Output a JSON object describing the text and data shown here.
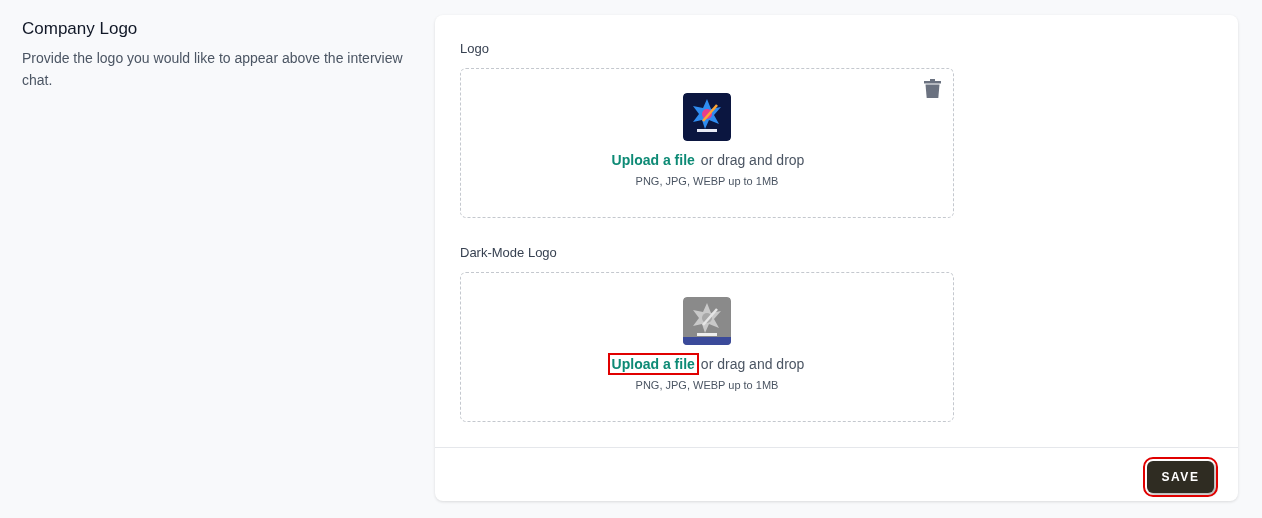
{
  "section": {
    "title": "Company Logo",
    "description": "Provide the logo you would like to appear above the interview chat."
  },
  "uploads": [
    {
      "label": "Logo",
      "deletable": true,
      "link": "Upload a file",
      "highlighted": false,
      "rest": "or drag and drop",
      "hint": "PNG, JPG, WEBP up to 1MB"
    },
    {
      "label": "Dark-Mode Logo",
      "deletable": false,
      "link": "Upload a file",
      "highlighted": true,
      "rest": "or drag and drop",
      "hint": "PNG, JPG, WEBP up to 1MB"
    }
  ],
  "save_button": {
    "label": "SAVE",
    "highlighted": true
  }
}
